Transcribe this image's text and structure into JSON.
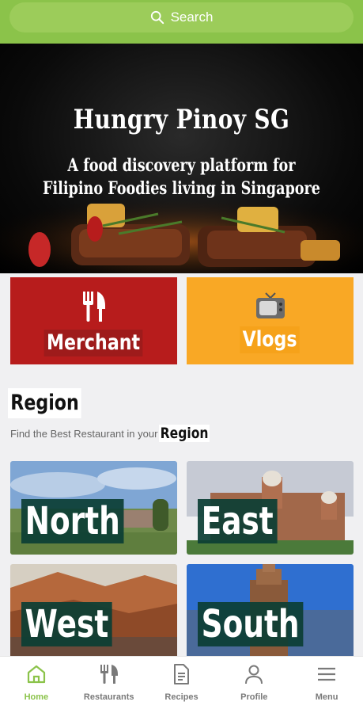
{
  "search": {
    "label": "Search",
    "icon": "search-icon"
  },
  "hero": {
    "title": "Hungry Pinoy SG",
    "subtitle_line1": "A food discovery platform for",
    "subtitle_line2": "Filipino Foodies living in Singapore"
  },
  "tiles": {
    "merchant": {
      "label": "Merchant",
      "icon": "fork-knife-icon",
      "color": "#b71c1c"
    },
    "vlogs": {
      "label": "Vlogs",
      "icon": "television-icon",
      "color": "#f9a825"
    }
  },
  "region": {
    "title": "Region",
    "subtitle_prefix": "Find the Best Restaurant in your",
    "subtitle_highlight": "Region",
    "cards": [
      {
        "label": "North"
      },
      {
        "label": "East"
      },
      {
        "label": "West"
      },
      {
        "label": "South"
      }
    ]
  },
  "nav": {
    "accent": "#8bc34a",
    "items": [
      {
        "label": "Home",
        "icon": "home-icon",
        "active": true
      },
      {
        "label": "Restaurants",
        "icon": "fork-knife-icon",
        "active": false
      },
      {
        "label": "Recipes",
        "icon": "document-icon",
        "active": false
      },
      {
        "label": "Profile",
        "icon": "person-icon",
        "active": false
      },
      {
        "label": "Menu",
        "icon": "hamburger-menu-icon",
        "active": false
      }
    ]
  }
}
